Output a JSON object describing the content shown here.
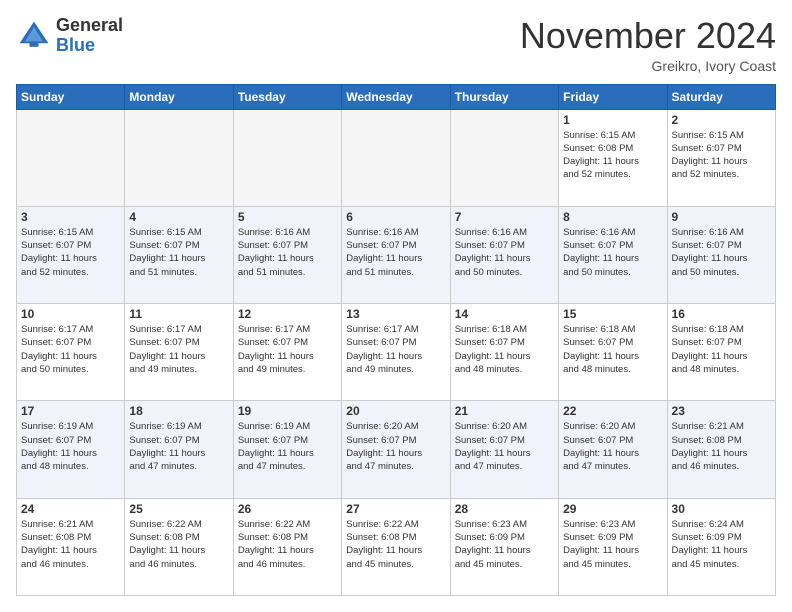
{
  "header": {
    "logo_general": "General",
    "logo_blue": "Blue",
    "title": "November 2024",
    "location": "Greikro, Ivory Coast"
  },
  "days_of_week": [
    "Sunday",
    "Monday",
    "Tuesday",
    "Wednesday",
    "Thursday",
    "Friday",
    "Saturday"
  ],
  "weeks": [
    [
      {
        "day": "",
        "info": ""
      },
      {
        "day": "",
        "info": ""
      },
      {
        "day": "",
        "info": ""
      },
      {
        "day": "",
        "info": ""
      },
      {
        "day": "",
        "info": ""
      },
      {
        "day": "1",
        "info": "Sunrise: 6:15 AM\nSunset: 6:08 PM\nDaylight: 11 hours\nand 52 minutes."
      },
      {
        "day": "2",
        "info": "Sunrise: 6:15 AM\nSunset: 6:07 PM\nDaylight: 11 hours\nand 52 minutes."
      }
    ],
    [
      {
        "day": "3",
        "info": "Sunrise: 6:15 AM\nSunset: 6:07 PM\nDaylight: 11 hours\nand 52 minutes."
      },
      {
        "day": "4",
        "info": "Sunrise: 6:15 AM\nSunset: 6:07 PM\nDaylight: 11 hours\nand 51 minutes."
      },
      {
        "day": "5",
        "info": "Sunrise: 6:16 AM\nSunset: 6:07 PM\nDaylight: 11 hours\nand 51 minutes."
      },
      {
        "day": "6",
        "info": "Sunrise: 6:16 AM\nSunset: 6:07 PM\nDaylight: 11 hours\nand 51 minutes."
      },
      {
        "day": "7",
        "info": "Sunrise: 6:16 AM\nSunset: 6:07 PM\nDaylight: 11 hours\nand 50 minutes."
      },
      {
        "day": "8",
        "info": "Sunrise: 6:16 AM\nSunset: 6:07 PM\nDaylight: 11 hours\nand 50 minutes."
      },
      {
        "day": "9",
        "info": "Sunrise: 6:16 AM\nSunset: 6:07 PM\nDaylight: 11 hours\nand 50 minutes."
      }
    ],
    [
      {
        "day": "10",
        "info": "Sunrise: 6:17 AM\nSunset: 6:07 PM\nDaylight: 11 hours\nand 50 minutes."
      },
      {
        "day": "11",
        "info": "Sunrise: 6:17 AM\nSunset: 6:07 PM\nDaylight: 11 hours\nand 49 minutes."
      },
      {
        "day": "12",
        "info": "Sunrise: 6:17 AM\nSunset: 6:07 PM\nDaylight: 11 hours\nand 49 minutes."
      },
      {
        "day": "13",
        "info": "Sunrise: 6:17 AM\nSunset: 6:07 PM\nDaylight: 11 hours\nand 49 minutes."
      },
      {
        "day": "14",
        "info": "Sunrise: 6:18 AM\nSunset: 6:07 PM\nDaylight: 11 hours\nand 48 minutes."
      },
      {
        "day": "15",
        "info": "Sunrise: 6:18 AM\nSunset: 6:07 PM\nDaylight: 11 hours\nand 48 minutes."
      },
      {
        "day": "16",
        "info": "Sunrise: 6:18 AM\nSunset: 6:07 PM\nDaylight: 11 hours\nand 48 minutes."
      }
    ],
    [
      {
        "day": "17",
        "info": "Sunrise: 6:19 AM\nSunset: 6:07 PM\nDaylight: 11 hours\nand 48 minutes."
      },
      {
        "day": "18",
        "info": "Sunrise: 6:19 AM\nSunset: 6:07 PM\nDaylight: 11 hours\nand 47 minutes."
      },
      {
        "day": "19",
        "info": "Sunrise: 6:19 AM\nSunset: 6:07 PM\nDaylight: 11 hours\nand 47 minutes."
      },
      {
        "day": "20",
        "info": "Sunrise: 6:20 AM\nSunset: 6:07 PM\nDaylight: 11 hours\nand 47 minutes."
      },
      {
        "day": "21",
        "info": "Sunrise: 6:20 AM\nSunset: 6:07 PM\nDaylight: 11 hours\nand 47 minutes."
      },
      {
        "day": "22",
        "info": "Sunrise: 6:20 AM\nSunset: 6:07 PM\nDaylight: 11 hours\nand 47 minutes."
      },
      {
        "day": "23",
        "info": "Sunrise: 6:21 AM\nSunset: 6:08 PM\nDaylight: 11 hours\nand 46 minutes."
      }
    ],
    [
      {
        "day": "24",
        "info": "Sunrise: 6:21 AM\nSunset: 6:08 PM\nDaylight: 11 hours\nand 46 minutes."
      },
      {
        "day": "25",
        "info": "Sunrise: 6:22 AM\nSunset: 6:08 PM\nDaylight: 11 hours\nand 46 minutes."
      },
      {
        "day": "26",
        "info": "Sunrise: 6:22 AM\nSunset: 6:08 PM\nDaylight: 11 hours\nand 46 minutes."
      },
      {
        "day": "27",
        "info": "Sunrise: 6:22 AM\nSunset: 6:08 PM\nDaylight: 11 hours\nand 45 minutes."
      },
      {
        "day": "28",
        "info": "Sunrise: 6:23 AM\nSunset: 6:09 PM\nDaylight: 11 hours\nand 45 minutes."
      },
      {
        "day": "29",
        "info": "Sunrise: 6:23 AM\nSunset: 6:09 PM\nDaylight: 11 hours\nand 45 minutes."
      },
      {
        "day": "30",
        "info": "Sunrise: 6:24 AM\nSunset: 6:09 PM\nDaylight: 11 hours\nand 45 minutes."
      }
    ]
  ]
}
